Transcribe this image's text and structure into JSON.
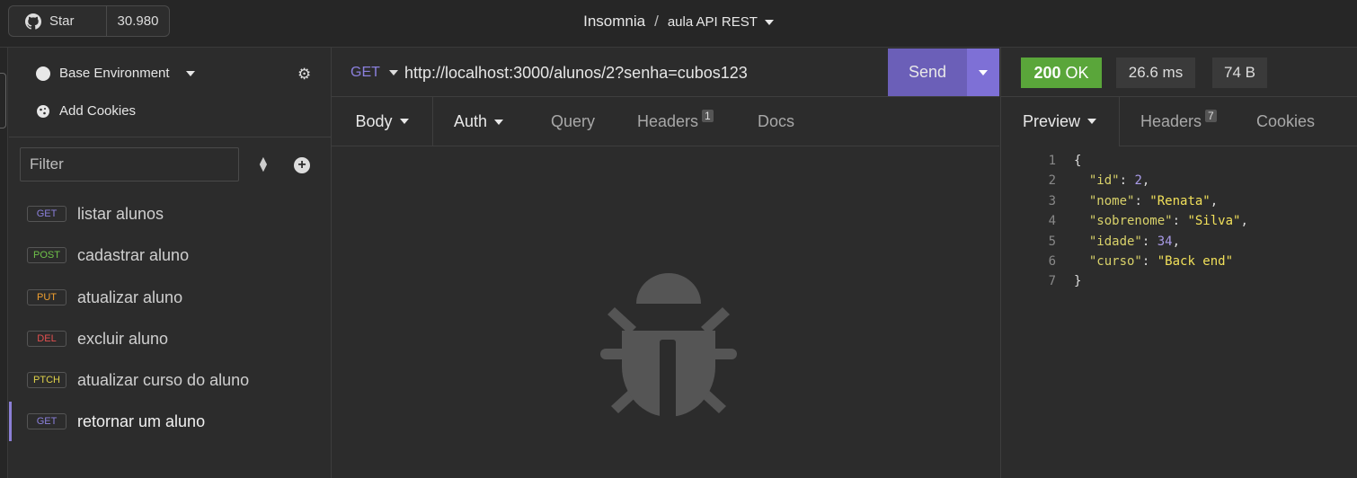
{
  "github": {
    "star_label": "Star",
    "star_count": "30.980"
  },
  "header": {
    "app_name": "Insomnia",
    "separator": "/",
    "project": "aula API REST"
  },
  "sidebar": {
    "environment": "Base Environment",
    "cookies": "Add Cookies",
    "filter_placeholder": "Filter",
    "requests": [
      {
        "method": "GET",
        "label": "listar alunos",
        "color": "#8b80dc"
      },
      {
        "method": "POST",
        "label": "cadastrar aluno",
        "color": "#6fc24a"
      },
      {
        "method": "PUT",
        "label": "atualizar aluno",
        "color": "#f0a030"
      },
      {
        "method": "DEL",
        "label": "excluir aluno",
        "color": "#e45050"
      },
      {
        "method": "PTCH",
        "label": "atualizar curso do aluno",
        "color": "#e0d24a"
      },
      {
        "method": "GET",
        "label": "retornar um aluno",
        "color": "#8b80dc",
        "active": true
      }
    ]
  },
  "request": {
    "method": "GET",
    "url": "http://localhost:3000/alunos/2?senha=cubos123",
    "send_label": "Send",
    "tabs": {
      "body": "Body",
      "auth": "Auth",
      "query": "Query",
      "headers": "Headers",
      "headers_count": "1",
      "docs": "Docs"
    }
  },
  "response": {
    "status_code": "200",
    "status_text": "OK",
    "time": "26.6 ms",
    "size": "74 B",
    "tabs": {
      "preview": "Preview",
      "headers": "Headers",
      "headers_count": "7",
      "cookies": "Cookies"
    },
    "line_numbers": [
      "1",
      "2",
      "3",
      "4",
      "5",
      "6",
      "7"
    ],
    "json": {
      "open": "{",
      "close": "}",
      "fields": [
        {
          "key": "\"id\"",
          "value": "2",
          "type": "number",
          "comma": ","
        },
        {
          "key": "\"nome\"",
          "value": "\"Renata\"",
          "type": "string",
          "comma": ","
        },
        {
          "key": "\"sobrenome\"",
          "value": "\"Silva\"",
          "type": "string",
          "comma": ","
        },
        {
          "key": "\"idade\"",
          "value": "34",
          "type": "number",
          "comma": ","
        },
        {
          "key": "\"curso\"",
          "value": "\"Back end\"",
          "type": "string",
          "comma": ""
        }
      ]
    }
  }
}
